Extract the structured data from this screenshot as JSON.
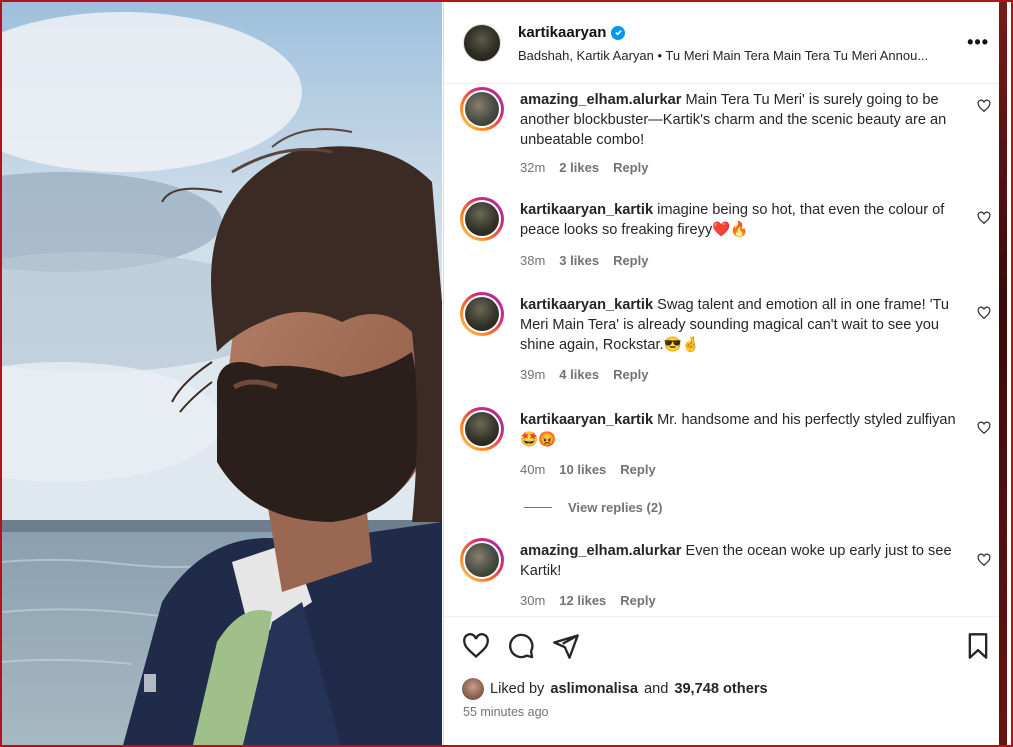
{
  "post": {
    "username": "kartikaaryan",
    "subtitle": "Badshah, Kartik Aaryan • Tu Meri Main Tera Main Tera Tu Meri Annou...",
    "more_icon": "more-options-icon"
  },
  "comments": [
    {
      "username": "amazing_elham.alurkar",
      "text": "Main Tera Tu Meri' is surely going to be another blockbuster—Kartik's charm and the scenic beauty are an unbeatable combo!",
      "time": "32m",
      "likes": "2 likes",
      "reply": "Reply"
    },
    {
      "username": "kartikaaryan_kartik",
      "text": "imagine being so hot, that even the colour of peace looks so freaking fireyy❤️🔥",
      "time": "38m",
      "likes": "3 likes",
      "reply": "Reply"
    },
    {
      "username": "kartikaaryan_kartik",
      "text": "Swag talent and emotion all in one frame! 'Tu Meri Main Tera' is already sounding magical can't wait to see you shine again, Rockstar.😎🤞",
      "time": "39m",
      "likes": "4 likes",
      "reply": "Reply"
    },
    {
      "username": "kartikaaryan_kartik",
      "text": "Mr. handsome and his perfectly styled zulfiyan🤩😡",
      "time": "40m",
      "likes": "10 likes",
      "reply": "Reply"
    },
    {
      "username": "amazing_elham.alurkar",
      "text": "Even the ocean woke up early just to see Kartik!",
      "time": "30m",
      "likes": "12 likes",
      "reply": "Reply"
    }
  ],
  "view_replies": "View replies (2)",
  "likes_summary": {
    "prefix": "Liked by",
    "user": "aslimonalisa",
    "middle": "and",
    "count": "39,748 others"
  },
  "posted_time": "55 minutes ago",
  "colors": {
    "accent_border": "#b3121d",
    "verified": "#0095f6",
    "muted_text": "#737373"
  }
}
